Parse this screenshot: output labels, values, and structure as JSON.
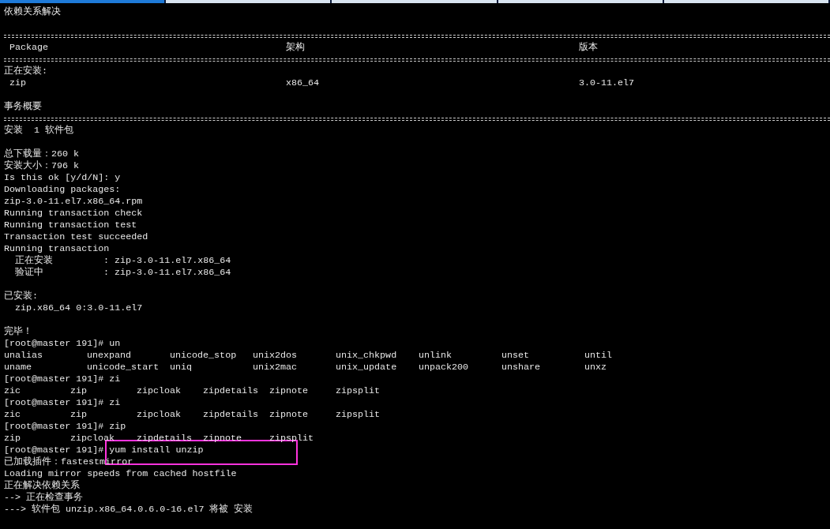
{
  "tabs": [
    {
      "selected": true
    },
    {
      "selected": false
    },
    {
      "selected": false
    },
    {
      "selected": false
    },
    {
      "selected": false
    }
  ],
  "lines": [
    {
      "kind": "text",
      "text": "依赖关系解决"
    },
    {
      "kind": "blank"
    },
    {
      "kind": "rule"
    },
    {
      "kind": "table",
      "cells": [
        "Package",
        "架构",
        "版本"
      ]
    },
    {
      "kind": "rule"
    },
    {
      "kind": "text",
      "text": "正在安装:"
    },
    {
      "kind": "table",
      "cells": [
        "zip",
        "x86_64",
        "3.0-11.el7"
      ]
    },
    {
      "kind": "blank"
    },
    {
      "kind": "text",
      "text": "事务概要"
    },
    {
      "kind": "rule"
    },
    {
      "kind": "text",
      "text": "安装  1 软件包"
    },
    {
      "kind": "blank"
    },
    {
      "kind": "text",
      "text": "总下载量：260 k"
    },
    {
      "kind": "text",
      "text": "安装大小：796 k"
    },
    {
      "kind": "text",
      "text": "Is this ok [y/d/N]: y"
    },
    {
      "kind": "text",
      "text": "Downloading packages:"
    },
    {
      "kind": "text",
      "text": "zip-3.0-11.el7.x86_64.rpm"
    },
    {
      "kind": "text",
      "text": "Running transaction check"
    },
    {
      "kind": "text",
      "text": "Running transaction test"
    },
    {
      "kind": "text",
      "text": "Transaction test succeeded"
    },
    {
      "kind": "text",
      "text": "Running transaction"
    },
    {
      "kind": "step",
      "cells": [
        "正在安装",
        ": zip-3.0-11.el7.x86_64"
      ]
    },
    {
      "kind": "step",
      "cells": [
        "验证中",
        ": zip-3.0-11.el7.x86_64"
      ]
    },
    {
      "kind": "blank"
    },
    {
      "kind": "text",
      "text": "已安装:"
    },
    {
      "kind": "indented",
      "text": "zip.x86_64 0:3.0-11.el7"
    },
    {
      "kind": "blank"
    },
    {
      "kind": "text",
      "text": "完毕！"
    },
    {
      "kind": "text",
      "text": "[root@master 191]# un"
    },
    {
      "kind": "wide_list",
      "cells": [
        "unalias",
        "unexpand",
        "unicode_stop",
        "unix2dos",
        "unix_chkpwd",
        "unlink",
        "unset",
        "until"
      ]
    },
    {
      "kind": "wide_list",
      "cells": [
        "uname",
        "unicode_start",
        "uniq",
        "unix2mac",
        "unix_update",
        "unpack200",
        "unshare",
        "unxz"
      ]
    },
    {
      "kind": "text",
      "text": "[root@master 191]# zi"
    },
    {
      "kind": "narrow_list",
      "cells": [
        "zic",
        "zip",
        "zipcloak",
        "zipdetails",
        "zipnote",
        "zipsplit"
      ]
    },
    {
      "kind": "text",
      "text": "[root@master 191]# zi"
    },
    {
      "kind": "narrow_list",
      "cells": [
        "zic",
        "zip",
        "zipcloak",
        "zipdetails",
        "zipnote",
        "zipsplit"
      ]
    },
    {
      "kind": "text",
      "text": "[root@master 191]# zip"
    },
    {
      "kind": "narrow_list",
      "cells": [
        "zip",
        "zipcloak",
        "zipdetails",
        "zipnote",
        "zipsplit"
      ]
    },
    {
      "kind": "text",
      "text": "[root@master 191]# yum install unzip"
    },
    {
      "kind": "text",
      "text": "已加载插件：fastestmirror"
    },
    {
      "kind": "text",
      "text": "Loading mirror speeds from cached hostfile"
    },
    {
      "kind": "text",
      "text": "正在解决依赖关系"
    },
    {
      "kind": "text",
      "text": "--> 正在检查事务"
    },
    {
      "kind": "text",
      "text": "---> 软件包 unzip.x86_64.0.6.0-16.el7 将被 安装"
    }
  ]
}
